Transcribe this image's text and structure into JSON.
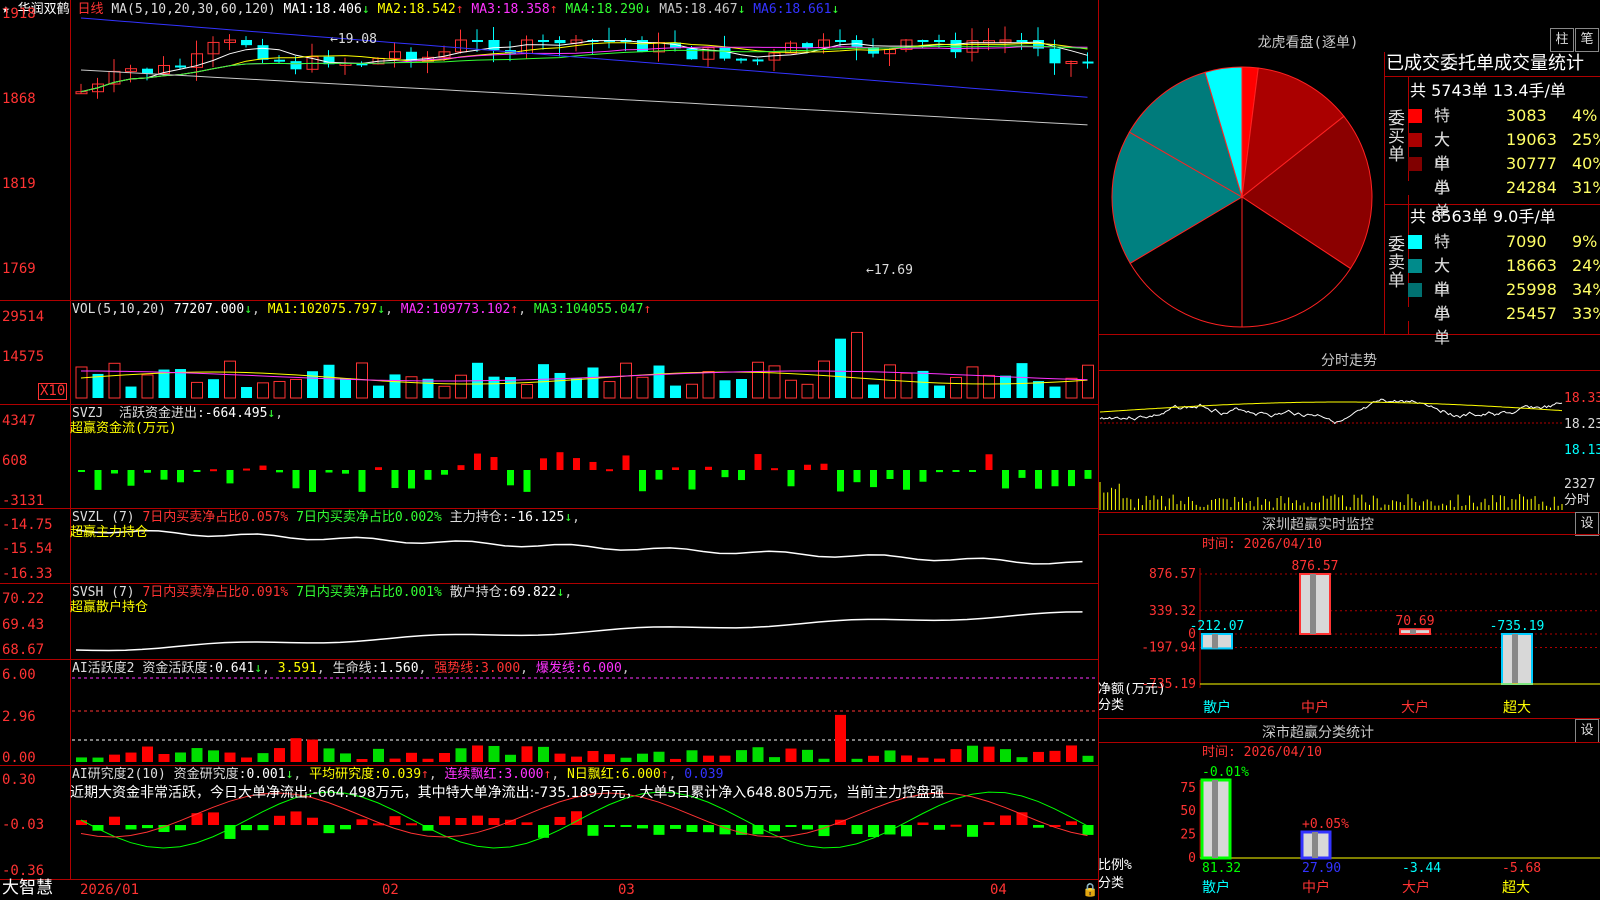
{
  "app_name": "大智慧",
  "kline": {
    "stock_name": "华润双鹤",
    "period": "日线",
    "ma_label": "MA(5,10,20,30,60,120)",
    "ma": [
      {
        "label": "MA1:",
        "value": "18.406",
        "arrow": "↓",
        "color": "#ffffff"
      },
      {
        "label": "MA2:",
        "value": "18.542",
        "arrow": "↑",
        "color": "#ffff00"
      },
      {
        "label": "MA3:",
        "value": "18.358",
        "arrow": "↑",
        "color": "#ff33ff"
      },
      {
        "label": "MA4:",
        "value": "18.290",
        "arrow": "↓",
        "color": "#33ff33"
      },
      {
        "label": "MA5:",
        "value": "18.467",
        "arrow": "↓",
        "color": "#c8c8c8"
      },
      {
        "label": "MA6:",
        "value": "18.661",
        "arrow": "↓",
        "color": "#3333ff"
      }
    ],
    "y_ticks": [
      "1918",
      "1868",
      "1819",
      "1769"
    ],
    "high_mark": "19.08",
    "low_mark": "17.69"
  },
  "vol": {
    "label": "VOL(5,10,20)",
    "value": "77207.000",
    "value_arrow": "↓",
    "ma1_label": "MA1:",
    "ma1": "102075.797",
    "ma1_arrow": "↓",
    "ma2_label": "MA2:",
    "ma2": "109773.102",
    "ma2_arrow": "↑",
    "ma3_label": "MA3:",
    "ma3": "104055.047",
    "ma3_arrow": "↑",
    "y_ticks": [
      "29514",
      "14575"
    ],
    "unit": "X10"
  },
  "svzj": {
    "label": "SVZJ",
    "title": "活跃资金进出:",
    "value": "-664.495",
    "value_arrow": "↓",
    "subtitle": "超赢资金流(万元)",
    "y_ticks": [
      "4347",
      "608",
      "-3131"
    ]
  },
  "svzl": {
    "label": "SVZL (7)",
    "buy_text": "7日内买卖净占比0.057%",
    "sell_text": "7日内买卖净占比0.002%",
    "main_label": "主力持仓:",
    "main_value": "-16.125",
    "main_arrow": "↓",
    "subtitle": "超赢主力持仓",
    "y_ticks": [
      "-14.75",
      "-15.54",
      "-16.33"
    ]
  },
  "svsh": {
    "label": "SVSH (7)",
    "buy_text": "7日内买卖净占比0.091%",
    "sell_text": "7日内买卖净占比0.001%",
    "main_label": "散户持仓:",
    "main_value": "69.822",
    "main_arrow": "↓",
    "subtitle": "超赢散户持仓",
    "y_ticks": [
      "70.22",
      "69.43",
      "68.67"
    ]
  },
  "ai_active": {
    "label": "AI活跃度2",
    "capital_label": "资金活跃度:",
    "capital_value": "0.641",
    "capital_arrow": "↓",
    "v2": "3.591",
    "life_label": "生命线:",
    "life_value": "1.560",
    "strong_label": "强势线:",
    "strong_value": "3.000",
    "burst_label": "爆发线:",
    "burst_value": "6.000",
    "y_ticks": [
      "6.00",
      "2.96",
      "0.00"
    ]
  },
  "ai_research": {
    "label": "AI研究度2(10)",
    "research_label": "资金研究度:",
    "research_value": "0.001",
    "research_arrow": "↓",
    "avg_label": "平均研究度:",
    "avg_value": "0.039",
    "avg_arrow": "↑",
    "cont_label": "连续飘红:",
    "cont_value": "3.000",
    "cont_arrow": "↑",
    "n_label": "N日飘红:",
    "n_value": "6.000",
    "n_arrow": "↑",
    "last_value": "0.039",
    "comment": "近期大资金非常活跃，今日大单净流出:-664.498万元，其中特大单净流出:-735.189万元，大单5日累计净入648.805万元，当前主力控盘强",
    "y_ticks": [
      "0.30",
      "-0.03",
      "-0.36"
    ]
  },
  "x_axis": [
    "2026/01",
    "02",
    "03",
    "04"
  ],
  "dragon": {
    "title": "龙虎看盘(逐单)",
    "btn_bar": "柱",
    "btn_pen": "笔",
    "header": "已成交委托单成交量统计",
    "buy_group": "委买单",
    "sell_group": "委卖单",
    "buy_total": "共 5743单 13.4手/单",
    "sell_total": "共 8563单 9.0手/单",
    "buy_rows": [
      {
        "name": "特大",
        "value": "3083",
        "pct": "4%",
        "color": "#ff0000"
      },
      {
        "name": "大单",
        "value": "19063",
        "pct": "25%",
        "color": "#aa0000"
      },
      {
        "name": "中单",
        "value": "30777",
        "pct": "40%",
        "color": "#800000"
      },
      {
        "name": "小单",
        "value": "24284",
        "pct": "31%",
        "color": "#000000"
      }
    ],
    "sell_rows": [
      {
        "name": "特大",
        "value": "7090",
        "pct": "9%",
        "color": "#00ffff"
      },
      {
        "name": "大单",
        "value": "18663",
        "pct": "24%",
        "color": "#008b8b"
      },
      {
        "name": "中单",
        "value": "25998",
        "pct": "34%",
        "color": "#007070"
      },
      {
        "name": "小单",
        "value": "25457",
        "pct": "33%",
        "color": "#000000"
      }
    ]
  },
  "intraday": {
    "title": "分时走势",
    "y_ticks": [
      "18.33",
      "18.23",
      "18.13"
    ],
    "vol_tick": "2327",
    "unit": "分时"
  },
  "sz_monitor": {
    "title": "深圳超赢实时监控",
    "btn": "设",
    "time_label": "时间: 2026/04/10",
    "y_ticks": [
      "876.57",
      "339.32",
      "0",
      "-197.94",
      "-735.19"
    ],
    "bars": [
      {
        "name": "散户",
        "label": "-212.07",
        "value": -212.07
      },
      {
        "name": "中户",
        "label": "876.57",
        "value": 876.57
      },
      {
        "name": "大户",
        "label": "70.69",
        "value": 70.69
      },
      {
        "name": "超大",
        "label": "-735.19",
        "value": -735.19
      }
    ],
    "unit": "净额(万元)",
    "category": "分类"
  },
  "sz_class": {
    "title": "深市超赢分类统计",
    "btn": "设",
    "time_label": "时间: 2026/04/10",
    "y_ticks": [
      "75",
      "50",
      "25",
      "0"
    ],
    "bars": [
      {
        "name": "散户",
        "label": "-0.01%",
        "bottom": "81.32"
      },
      {
        "name": "中户",
        "label": "+0.05%",
        "bottom": "27.90"
      },
      {
        "name": "大户",
        "label": "",
        "bottom": "-3.44"
      },
      {
        "name": "超大",
        "label": "",
        "bottom": "-5.68"
      }
    ],
    "unit": "比例%",
    "category": "分类"
  }
}
